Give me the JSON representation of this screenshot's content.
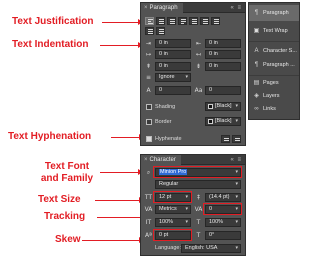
{
  "annotations": {
    "justification": "Text Justification",
    "indentation": "Text Indentation",
    "hyphenation": "Text Hyphenation",
    "font_line1": "Text Font",
    "font_line2": "and Family",
    "size": "Text Size",
    "tracking": "Tracking",
    "skew": "Skew",
    "color": "#e21d24"
  },
  "paragraph_panel": {
    "tab": "Paragraph",
    "indent_left": "0 in",
    "indent_right": "0 in",
    "first_line": "0 in",
    "last_line": "0 in",
    "space_before": "0 in",
    "space_after": "0 in",
    "align_to": "Ignore",
    "drop_cap_lines": "0",
    "drop_cap_chars": "0",
    "shading_label": "Shading",
    "shading_swatch": "[Black]",
    "border_label": "Border",
    "border_swatch": "[Black]",
    "hyphenate_label": "Hyphenate"
  },
  "character_panel": {
    "tab": "Character",
    "font_family": "Minion Pro",
    "font_style": "Regular",
    "size": "12 pt",
    "leading": "(14.4 pt)",
    "kerning": "Metrics",
    "tracking": "0",
    "vertical_scale": "100%",
    "horizontal_scale": "100%",
    "baseline_shift": "0 pt",
    "skew": "0°",
    "language_label": "Language:",
    "language": "English: USA"
  },
  "dock": {
    "items": [
      "Paragraph",
      "Text Wrap",
      "Character S...",
      "Paragraph ...",
      "Pages",
      "Layers",
      "Links"
    ]
  }
}
